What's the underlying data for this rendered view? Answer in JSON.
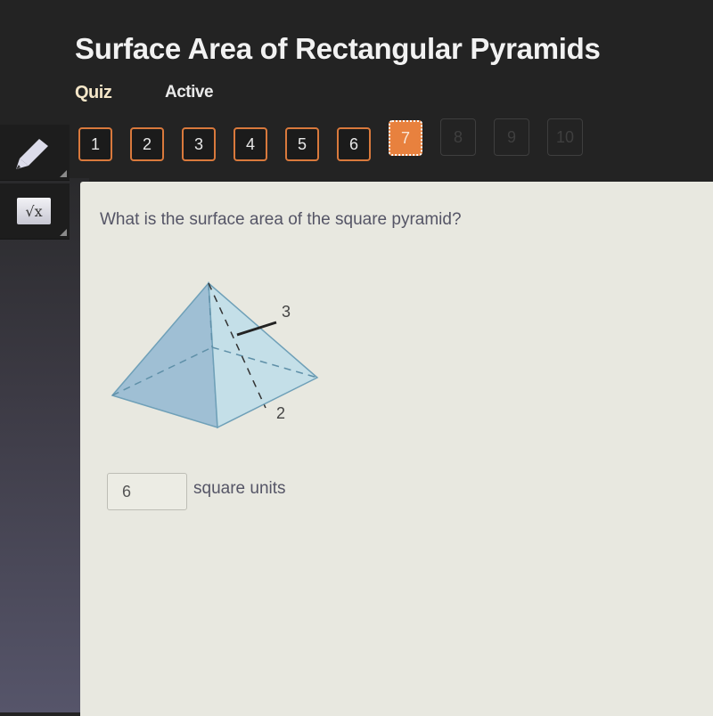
{
  "header": {
    "title": "Surface Area of Rectangular Pyramids",
    "type_label": "Quiz",
    "status_label": "Active"
  },
  "tools": [
    {
      "name": "pencil",
      "icon": "pencil-icon"
    },
    {
      "name": "math-tool",
      "icon": "square-root-x-icon",
      "glyph": "√x"
    }
  ],
  "question_nav": {
    "current": 7,
    "items": [
      {
        "label": "1",
        "state": "answered"
      },
      {
        "label": "2",
        "state": "answered"
      },
      {
        "label": "3",
        "state": "answered"
      },
      {
        "label": "4",
        "state": "answered"
      },
      {
        "label": "5",
        "state": "answered"
      },
      {
        "label": "6",
        "state": "answered"
      },
      {
        "label": "7",
        "state": "current"
      },
      {
        "label": "8",
        "state": "locked"
      },
      {
        "label": "9",
        "state": "locked"
      },
      {
        "label": "10",
        "state": "locked"
      }
    ]
  },
  "question": {
    "text": "What is the surface area of the square pyramid?",
    "figure": {
      "shape": "square pyramid",
      "slant_height_label": "3",
      "base_edge_label": "2"
    },
    "answer": {
      "value": "6",
      "units": "square units"
    }
  },
  "colors": {
    "accent": "#e8813e",
    "header_bg": "#232323",
    "panel_bg": "#e8e8e0",
    "pyramid_fill": "#a9c9da"
  }
}
